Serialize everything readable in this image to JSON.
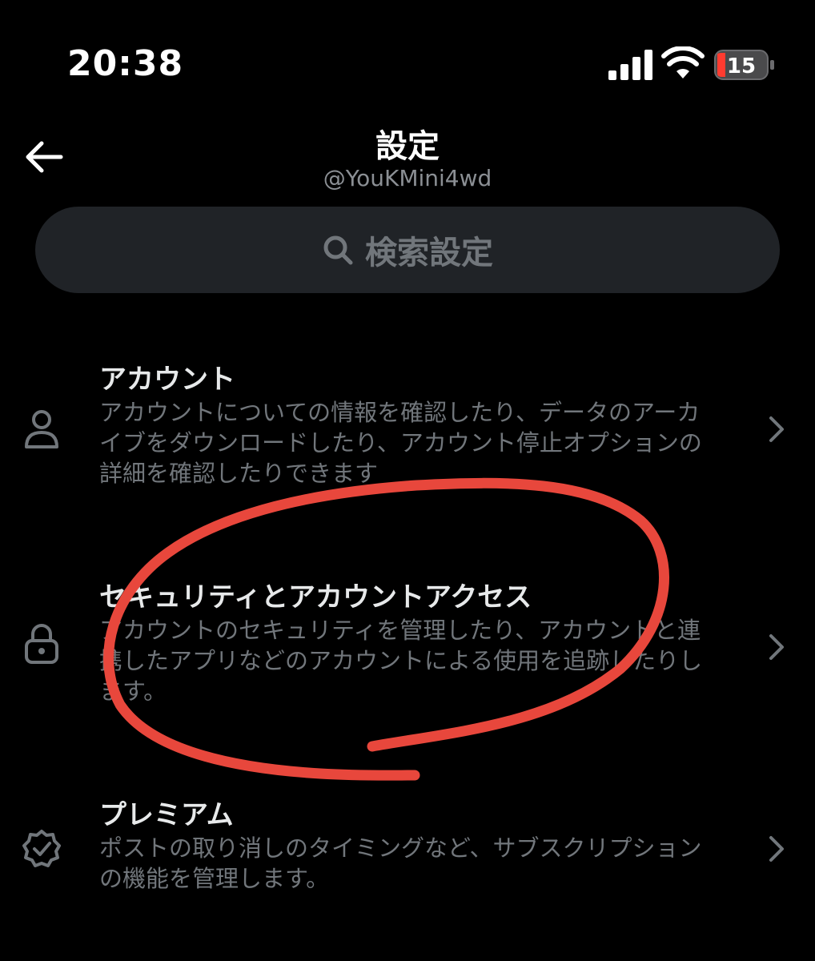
{
  "status_bar": {
    "time": "20:38",
    "battery_level": "15",
    "battery_color": "#ff3b30"
  },
  "header": {
    "title": "設定",
    "username": "@YouKMini4wd"
  },
  "search": {
    "placeholder": "検索設定"
  },
  "settings": [
    {
      "title": "アカウント",
      "description": "アカウントについての情報を確認したり、データのアーカイブをダウンロードしたり、アカウント停止オプションの詳細を確認したりできます",
      "icon": "person-icon"
    },
    {
      "title": "セキュリティとアカウントアクセス",
      "description": "アカウントのセキュリティを管理したり、アカウントと連携したアプリなどのアカウントによる使用を追跡したりします。",
      "icon": "lock-icon"
    },
    {
      "title": "プレミアム",
      "description": "ポストの取り消しのタイミングなど、サブスクリプションの機能を管理します。",
      "icon": "verified-badge-icon"
    }
  ],
  "annotation_color": "#e8473c"
}
